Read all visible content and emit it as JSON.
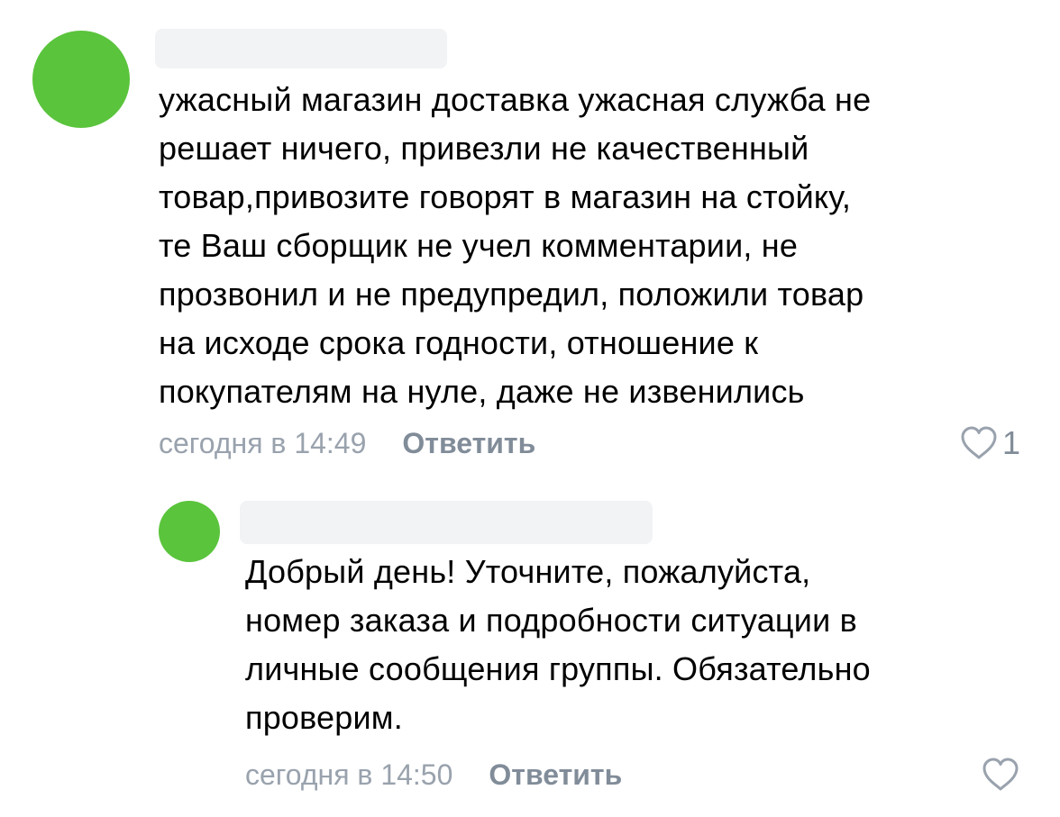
{
  "colors": {
    "avatar": "#5ac43c",
    "name_placeholder": "#f2f3f5",
    "text": "#000000",
    "timestamp": "#99a2ad",
    "reply": "#818c99",
    "icon": "#99a2ad"
  },
  "comment": {
    "text": "ужасный магазин доставка ужасная служба не\nрешает ничего, привезли не качественный\nтовар,привозите говорят в магазин на стойку,\nте Ваш сборщик не учел комментарии, не\nпрозвонил и не предупредил, положили товар\nна исходе срока годности, отношение к\nпокупателям на нуле, даже не извенились",
    "timestamp": "сегодня в 14:49",
    "reply_label": "Ответить",
    "like_icon": "heart-icon",
    "like_count": "1"
  },
  "reply": {
    "text": "Добрый день! Уточните, пожалуйста,\nномер заказа и подробности ситуации в\nличные сообщения группы. Обязательно\nпроверим.",
    "timestamp": "сегодня в 14:50",
    "reply_label": "Ответить",
    "like_icon": "heart-icon"
  }
}
